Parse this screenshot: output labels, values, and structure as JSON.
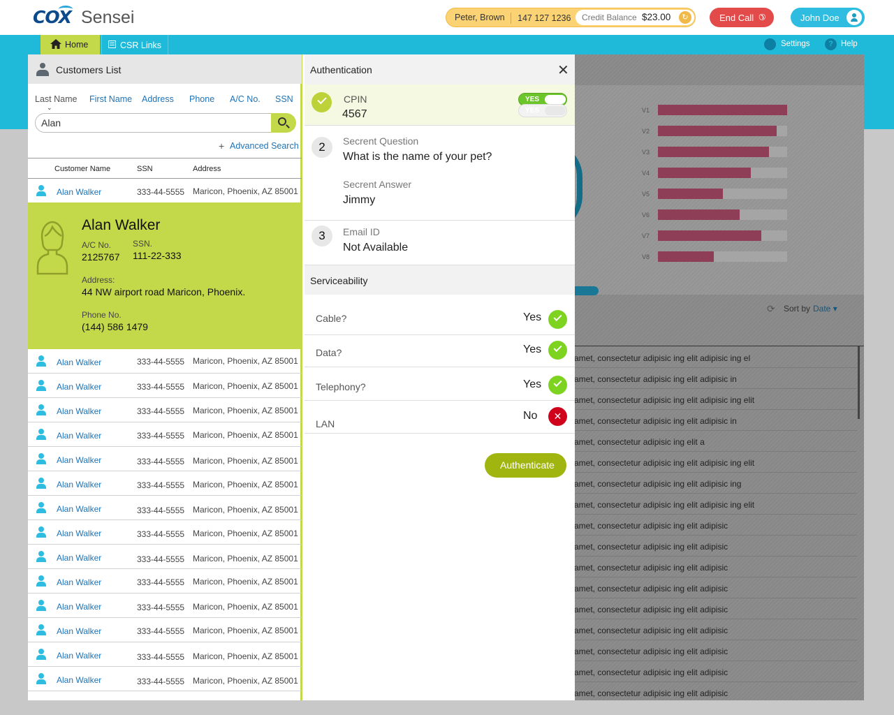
{
  "header": {
    "logo_text": "COX",
    "app_name": "Sensei",
    "caller_name": "Peter, Brown",
    "caller_phone": "147 127 1236",
    "credit_label": "Credit Balance",
    "credit_amount": "$23.00",
    "end_call_label": "End Call",
    "user_name": "John Doe"
  },
  "nav": {
    "tabs": [
      {
        "label": "Home",
        "icon": "home-icon",
        "active": true
      },
      {
        "label": "CSR Links",
        "icon": "list-icon",
        "active": false
      }
    ],
    "settings_label": "Settings",
    "help_label": "Help",
    "help_glyph": "?"
  },
  "customers": {
    "title": "Customers List",
    "filters": [
      "Last Name",
      "First Name",
      "Address",
      "Phone",
      "A/C No.",
      "SSN"
    ],
    "active_filter": "Last Name",
    "search_value": "Alan",
    "advanced_search_label": "Advanced Search",
    "columns": [
      "Customer Name",
      "SSN",
      "Address"
    ],
    "rows": [
      {
        "name": "Alan Walker",
        "ssn": "333-44-5555",
        "address": "Maricon, Phoenix, AZ 85001"
      },
      {
        "name": "Alan Walker",
        "ssn": "333-44-5555",
        "address": "Maricon, Phoenix, AZ 85001"
      },
      {
        "name": "Alan Walker",
        "ssn": "333-44-5555",
        "address": "Maricon, Phoenix, AZ 85001"
      },
      {
        "name": "Alan Walker",
        "ssn": "333-44-5555",
        "address": "Maricon, Phoenix, AZ 85001"
      },
      {
        "name": "Alan Walker",
        "ssn": "333-44-5555",
        "address": "Maricon, Phoenix, AZ 85001"
      },
      {
        "name": "Alan Walker",
        "ssn": "333-44-5555",
        "address": "Maricon, Phoenix, AZ 85001"
      },
      {
        "name": "Alan Walker",
        "ssn": "333-44-5555",
        "address": "Maricon, Phoenix, AZ 85001"
      },
      {
        "name": "Alan Walker",
        "ssn": "333-44-5555",
        "address": "Maricon, Phoenix, AZ 85001"
      },
      {
        "name": "Alan Walker",
        "ssn": "333-44-5555",
        "address": "Maricon, Phoenix, AZ 85001"
      },
      {
        "name": "Alan Walker",
        "ssn": "333-44-5555",
        "address": "Maricon, Phoenix, AZ 85001"
      },
      {
        "name": "Alan Walker",
        "ssn": "333-44-5555",
        "address": "Maricon, Phoenix, AZ 85001"
      },
      {
        "name": "Alan Walker",
        "ssn": "333-44-5555",
        "address": "Maricon, Phoenix, AZ 85001"
      },
      {
        "name": "Alan Walker",
        "ssn": "333-44-5555",
        "address": "Maricon, Phoenix, AZ 85001"
      },
      {
        "name": "Alan Walker",
        "ssn": "333-44-5555",
        "address": "Maricon, Phoenix, AZ 85001"
      },
      {
        "name": "Alan Walker",
        "ssn": "333-44-5555",
        "address": "Maricon, Phoenix, AZ 85001"
      }
    ],
    "selected": {
      "name": "Alan Walker",
      "ac_label": "A/C No.",
      "ac_value": "2125767",
      "ssn_label": "SSN.",
      "ssn_value": "111-22-333",
      "address_label": "Address:",
      "address_value": "44 NW airport road Maricon, Phoenix.",
      "phone_label": "Phone No.",
      "phone_value": "(144) 586 1479"
    }
  },
  "auth": {
    "title": "Authentication",
    "cpin_label": "CPIN",
    "cpin_value": "4567",
    "toggle_on_label": "YES",
    "toggle_off_label": "YES",
    "step2_num": "2",
    "question_label": "Secrent Question",
    "question_value": "What is the name of your pet?",
    "answer_label": "Secrent Answer",
    "answer_value": "Jimmy",
    "step3_num": "3",
    "email_label": "Email ID",
    "email_value": "Not Available",
    "serviceability_title": "Serviceability",
    "services": [
      {
        "name": "Cable?",
        "value": "Yes",
        "status": "ok"
      },
      {
        "name": "Data?",
        "value": "Yes",
        "status": "ok"
      },
      {
        "name": "Telephony?",
        "value": "Yes",
        "status": "ok"
      },
      {
        "name": "LAN",
        "value": "No",
        "status": "no"
      }
    ],
    "authenticate_label": "Authenticate"
  },
  "background": {
    "bars": [
      {
        "label": "V1",
        "value": 1.0
      },
      {
        "label": "V2",
        "value": 0.92
      },
      {
        "label": "V3",
        "value": 0.86
      },
      {
        "label": "V4",
        "value": 0.72
      },
      {
        "label": "V5",
        "value": 0.5
      },
      {
        "label": "V6",
        "value": 0.63
      },
      {
        "label": "V7",
        "value": 0.8
      },
      {
        "label": "V8",
        "value": 0.43
      }
    ],
    "sort_label": "Sort by",
    "sort_value": "Date",
    "lines": [
      "amet, consectetur adipisic ing elit adipisic ing el",
      "amet, consectetur adipisic ing elit adipisic in",
      "amet, consectetur adipisic ing elit adipisic ing elit",
      "amet, consectetur adipisic ing elit adipisic in",
      "amet, consectetur adipisic ing elit a",
      "amet, consectetur adipisic ing elit adipisic ing elit",
      "amet, consectetur adipisic ing elit adipisic ing",
      "amet, consectetur adipisic ing elit adipisic ing elit",
      "amet, consectetur adipisic ing elit adipisic",
      "amet, consectetur adipisic ing elit adipisic",
      "amet, consectetur adipisic ing elit adipisic",
      "amet, consectetur adipisic ing elit adipisic",
      "amet, consectetur adipisic ing elit adipisic",
      "amet, consectetur adipisic ing elit adipisic",
      "amet, consectetur adipisic ing elit adipisic",
      "amet, consectetur adipisic ing elit adipisic",
      "amet, consectetur adipisic ing elit adipisic"
    ]
  },
  "colors": {
    "teal": "#1fbad9",
    "lime": "#c4d94a",
    "caller_yellow": "#fcd374",
    "end_call_red": "#e34b4b",
    "bar_fill": "#8e3f57",
    "authenticate": "#a1b510"
  }
}
